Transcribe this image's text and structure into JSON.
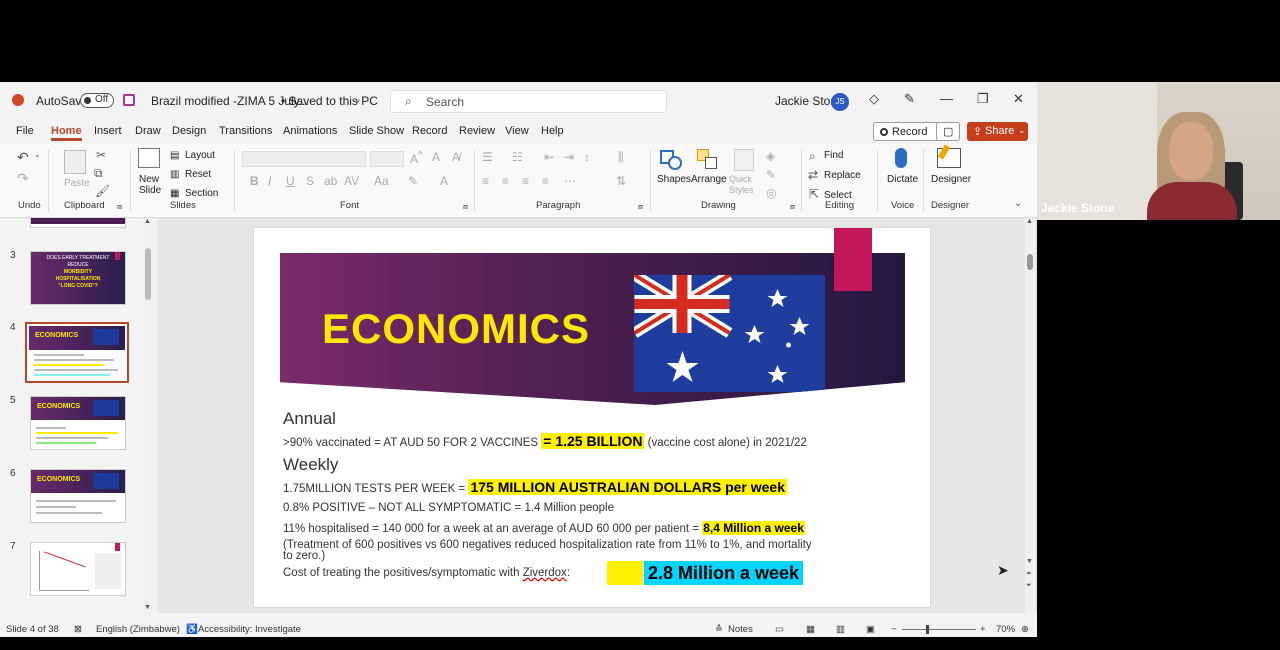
{
  "titlebar": {
    "autosave_label": "AutoSave",
    "autosave_state": "Off",
    "document_title": "Brazil modified -ZIMA 5 July...",
    "save_status": "• Saved to this PC",
    "search_placeholder": "Search",
    "user_name": "Jackie Stone",
    "user_initials": "JS"
  },
  "tabs": [
    "File",
    "Home",
    "Insert",
    "Draw",
    "Design",
    "Transitions",
    "Animations",
    "Slide Show",
    "Record",
    "Review",
    "View",
    "Help"
  ],
  "active_tab": "Home",
  "tab_buttons": {
    "record": "Record",
    "share": "Share"
  },
  "ribbon": {
    "groups": [
      "Undo",
      "Clipboard",
      "Slides",
      "Font",
      "Paragraph",
      "Drawing",
      "Editing",
      "Voice",
      "Designer"
    ],
    "clipboard": {
      "paste": "Paste"
    },
    "slides": {
      "new_slide": "New Slide",
      "layout": "Layout",
      "reset": "Reset",
      "section": "Section"
    },
    "drawing": {
      "shapes": "Shapes",
      "arrange": "Arrange",
      "quick_styles": "Quick Styles"
    },
    "editing": {
      "find": "Find",
      "replace": "Replace",
      "select": "Select"
    },
    "voice": {
      "dictate": "Dictate"
    },
    "designer": {
      "designer": "Designer"
    }
  },
  "slide_panel": {
    "numbers": [
      "3",
      "4",
      "5",
      "6",
      "7"
    ],
    "selected": "4",
    "slide3_lines": [
      "DOES EARLY TREATMENT",
      "REDUCE",
      "MORBIDITY",
      "HOSPITALISATION",
      "\"LONG COVID\"?"
    ],
    "econ_label": "ECONOMICS"
  },
  "slide": {
    "title": "ECONOMICS",
    "annual_heading": "Annual",
    "annual_line_pre": ">90% vaccinated = AT AUD 50 FOR 2 VACCINES",
    "annual_line_hl": "= 1.25 BILLION",
    "annual_line_post": "(vaccine cost alone) in 2021/22",
    "weekly_heading": "Weekly",
    "tests_pre": "1.75MILLION TESTS PER WEEK =",
    "tests_hl": "175 MILLION AUSTRALIAN DOLLARS per week",
    "positive_line": "0.8% POSITIVE – NOT ALL SYMPTOMATIC = 1.4 Million people",
    "hosp_pre": "11% hospitalised = 140 000 for a week at an average of AUD 60 000 per patient =",
    "hosp_hl": "8,4 Million a week",
    "treatment_line1": "(Treatment of 600 positives vs 600 negatives reduced hospitalization rate from 11% to 1%, and mortality",
    "treatment_line2": "to zero.)",
    "cost_pre": "Cost of treating the positives/symptomatic with",
    "cost_drug": "Ziverdox",
    "cost_colon": ":",
    "cost_hl": "2.8 Million a week"
  },
  "status": {
    "slide_of": "Slide 4 of 38",
    "language": "English (Zimbabwe)",
    "accessibility": "Accessibility: Investigate",
    "notes": "Notes",
    "zoom": "70%"
  },
  "video": {
    "participant": "Jackie Stone"
  }
}
